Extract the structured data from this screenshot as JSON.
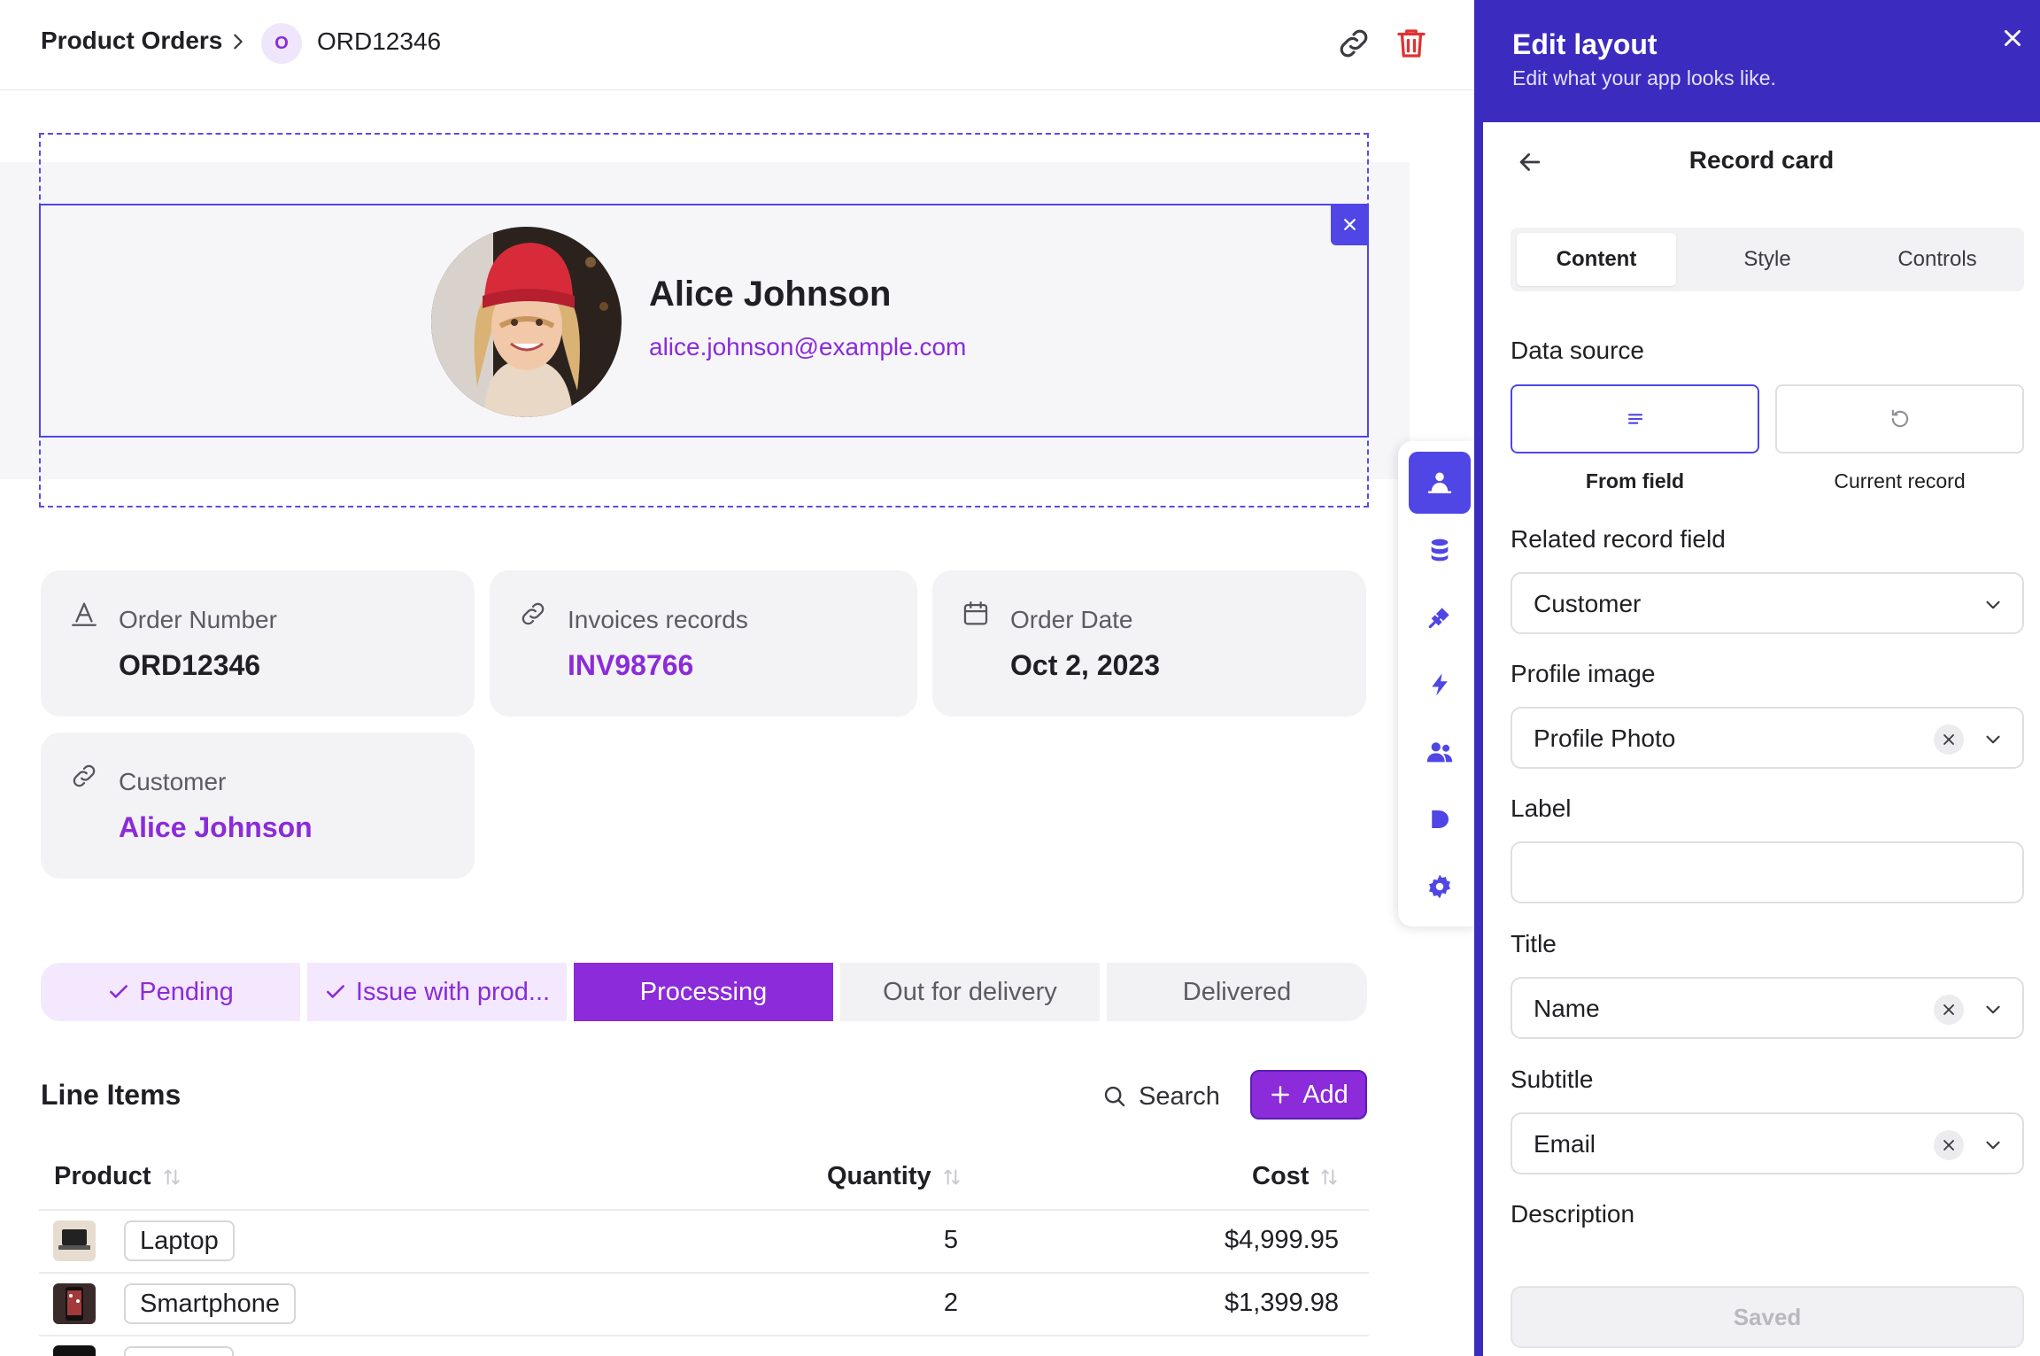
{
  "breadcrumb": {
    "root": "Product Orders",
    "avatar_letter": "O",
    "current": "ORD12346"
  },
  "record_card": {
    "name": "Alice Johnson",
    "email": "alice.johnson@example.com"
  },
  "fields": [
    {
      "label": "Order Number",
      "value": "ORD12346",
      "icon": "text-field-icon"
    },
    {
      "label": "Invoices records",
      "value": "INV98766",
      "icon": "link-icon"
    },
    {
      "label": "Order Date",
      "value": "Oct 2, 2023",
      "icon": "calendar-icon"
    },
    {
      "label": "Customer",
      "value": "Alice Johnson",
      "icon": "link-icon"
    }
  ],
  "status_steps": [
    {
      "label": "Pending",
      "state": "done"
    },
    {
      "label": "Issue with prod...",
      "state": "done"
    },
    {
      "label": "Processing",
      "state": "active"
    },
    {
      "label": "Out for delivery",
      "state": "todo"
    },
    {
      "label": "Delivered",
      "state": "todo"
    }
  ],
  "line_items": {
    "title": "Line Items",
    "search_label": "Search",
    "add_label": "Add",
    "columns": {
      "product": "Product",
      "quantity": "Quantity",
      "cost": "Cost"
    },
    "rows": [
      {
        "product": "Laptop",
        "quantity": "5",
        "cost": "$4,999.95"
      },
      {
        "product": "Smartphone",
        "quantity": "2",
        "cost": "$1,399.98"
      }
    ]
  },
  "rail": [
    "user-card-icon",
    "database-icon",
    "plug-icon",
    "lightning-icon",
    "users-icon",
    "play-icon",
    "gear-icon"
  ],
  "panel": {
    "title": "Edit layout",
    "subtitle": "Edit what your app looks like.",
    "section_title": "Record card",
    "tabs": [
      "Content",
      "Style",
      "Controls"
    ],
    "data_source_label": "Data source",
    "data_source_options": [
      "From field",
      "Current record"
    ],
    "related_field_label": "Related record field",
    "related_field_value": "Customer",
    "profile_image_label": "Profile image",
    "profile_image_value": "Profile Photo",
    "label_label": "Label",
    "label_value": "",
    "title_label": "Title",
    "title_value": "Name",
    "subtitle_label": "Subtitle",
    "subtitle_value": "Email",
    "description_label": "Description",
    "saved_label": "Saved"
  },
  "colors": {
    "accent_purple": "#8b2bd9",
    "panel_indigo": "#3b2bbf",
    "selection_blue": "#4f46e5",
    "delete_red": "#e03131"
  }
}
